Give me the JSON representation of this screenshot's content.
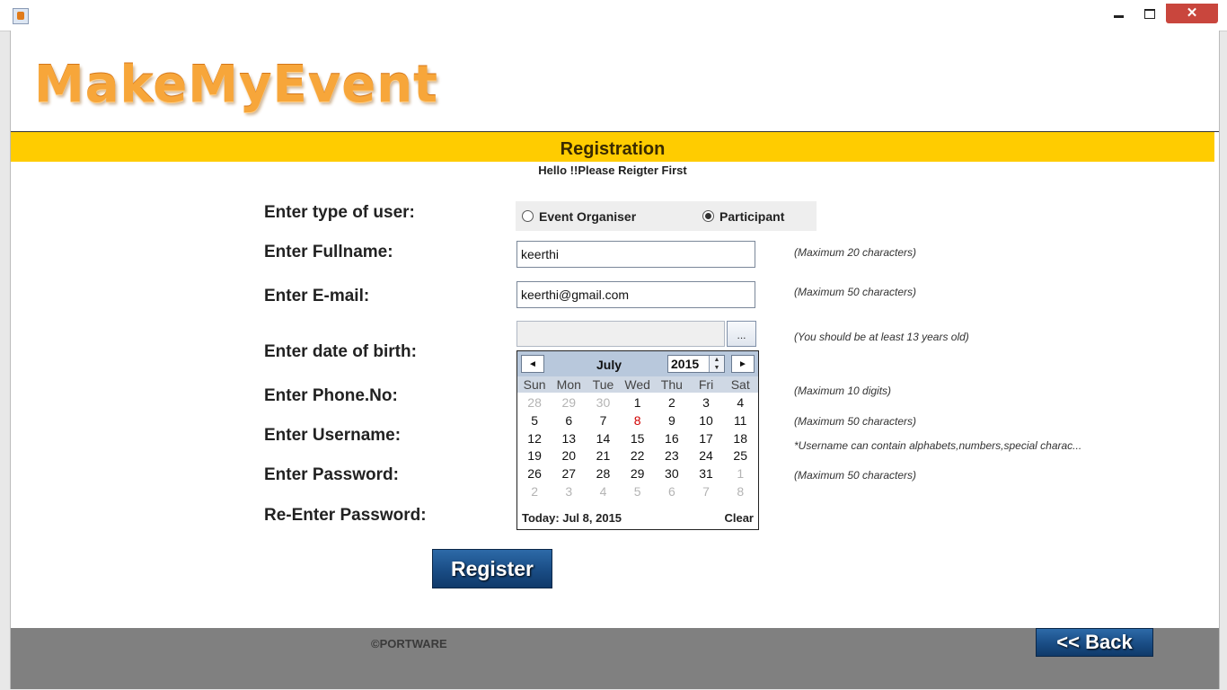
{
  "window": {
    "minimize": "",
    "maximize": "",
    "close": "✕"
  },
  "logo": "MakeMyEvent",
  "banner": {
    "title": "Registration",
    "subtitle": "Hello !!Please Reigter First"
  },
  "form": {
    "user_type": {
      "label": "Enter type of user:",
      "options": [
        "Event Organiser",
        "Participant"
      ],
      "selected": "Participant"
    },
    "fullname": {
      "label": "Enter Fullname:",
      "value": "keerthi",
      "hint": "(Maximum 20 characters)"
    },
    "email": {
      "label": "Enter E-mail:",
      "value": "keerthi@gmail.com",
      "hint": "(Maximum 50 characters)"
    },
    "dob": {
      "label": "Enter date of birth:",
      "value": "",
      "button": "...",
      "hint": "(You should be at least 13 years old)"
    },
    "phone": {
      "label": "Enter Phone.No:",
      "hint": "(Maximum 10 digits)"
    },
    "username": {
      "label": "Enter Username:",
      "hint": "(Maximum 50 characters)",
      "hint2": "*Username can contain alphabets,numbers,special charac..."
    },
    "password": {
      "label": "Enter Password:",
      "hint": "(Maximum 50 characters)"
    },
    "reenter": {
      "label": "Re-Enter Password:"
    },
    "register_label": "Register"
  },
  "calendar": {
    "prev": "◄",
    "next": "►",
    "month": "July",
    "year": "2015",
    "weekdays": [
      "Sun",
      "Mon",
      "Tue",
      "Wed",
      "Thu",
      "Fri",
      "Sat"
    ],
    "weeks": [
      [
        "28",
        "29",
        "30",
        "1",
        "2",
        "3",
        "4"
      ],
      [
        "5",
        "6",
        "7",
        "8",
        "9",
        "10",
        "11"
      ],
      [
        "12",
        "13",
        "14",
        "15",
        "16",
        "17",
        "18"
      ],
      [
        "19",
        "20",
        "21",
        "22",
        "23",
        "24",
        "25"
      ],
      [
        "26",
        "27",
        "28",
        "29",
        "30",
        "31",
        "1"
      ],
      [
        "2",
        "3",
        "4",
        "5",
        "6",
        "7",
        "8"
      ]
    ],
    "today_label": "Today: Jul 8, 2015",
    "clear_label": "Clear"
  },
  "footer": {
    "copyright": "©PORTWARE",
    "back_label": "<< Back"
  },
  "colors": {
    "banner": "#ffcc00",
    "logo": "#f7a63a",
    "button": "#1b4f88",
    "footer": "#808080",
    "today": "#d10000"
  }
}
